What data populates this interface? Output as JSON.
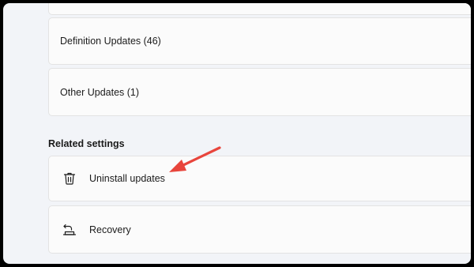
{
  "updates": {
    "definition_label": "Definition Updates (46)",
    "other_label": "Other Updates (1)"
  },
  "related": {
    "title": "Related settings",
    "uninstall_label": "Uninstall updates",
    "recovery_label": "Recovery"
  },
  "icons": {
    "uninstall": "trash-icon",
    "recovery": "recovery-icon"
  },
  "colors": {
    "annotation_arrow": "#e8453c",
    "card_background": "#fbfbfb",
    "page_background": "#f2f4f8"
  }
}
